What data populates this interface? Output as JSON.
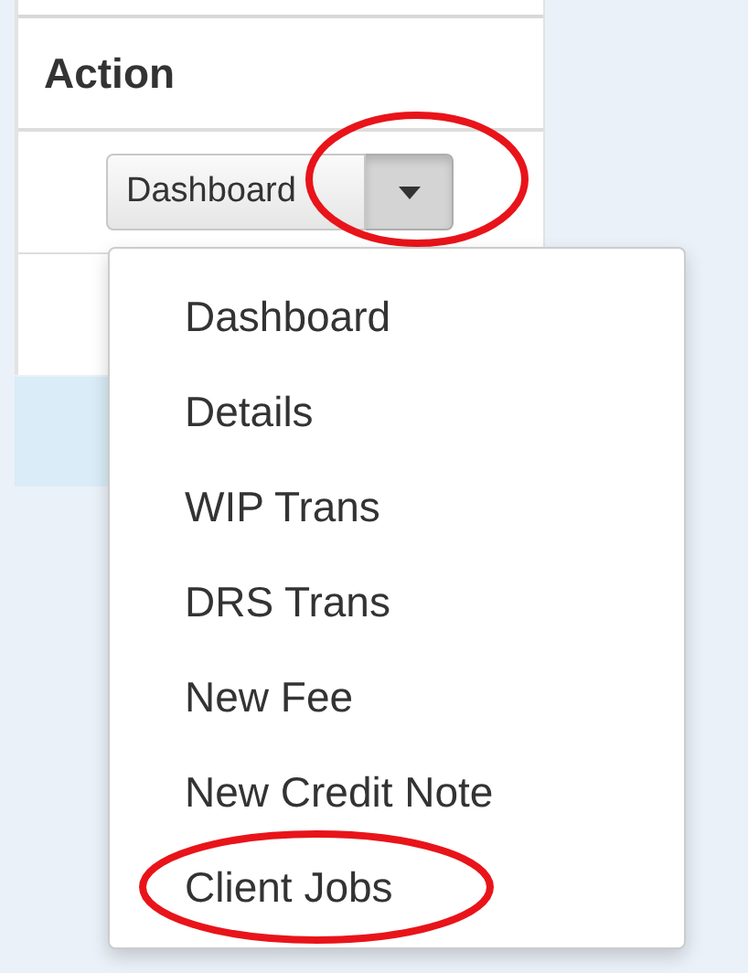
{
  "table": {
    "columns": [
      {
        "label": "Action"
      }
    ],
    "split_button": {
      "label": "Dashboard",
      "toggle_pressed": true,
      "toggle_circled": true
    }
  },
  "dropdown_menu": {
    "items": [
      {
        "label": "Dashboard",
        "circled": false
      },
      {
        "label": "Details",
        "circled": false
      },
      {
        "label": "WIP Trans",
        "circled": false
      },
      {
        "label": "DRS Trans",
        "circled": false
      },
      {
        "label": "New Fee",
        "circled": false
      },
      {
        "label": "New Credit Note",
        "circled": false
      },
      {
        "label": "Client Jobs",
        "circled": true
      }
    ]
  }
}
